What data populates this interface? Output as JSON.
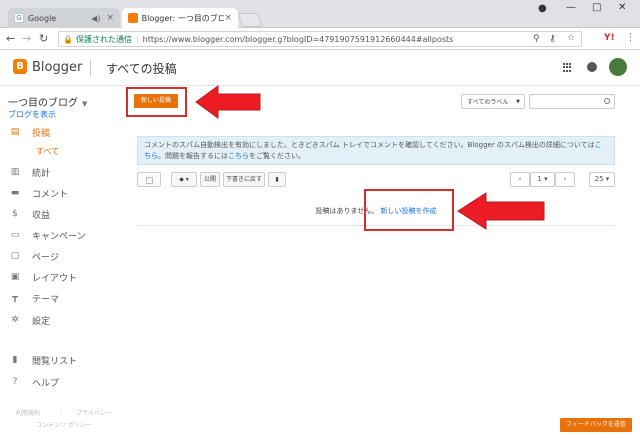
{
  "browser": {
    "tabs": [
      {
        "label": "Google"
      },
      {
        "label": "Blogger: 一つ目のブログ -"
      }
    ],
    "address": {
      "secure_label": "保護された通信",
      "url": "https://www.blogger.com/blogger.g?blogID=4791907591912660444#allposts"
    }
  },
  "header": {
    "app_name": "Blogger",
    "page_title": "すべての投稿",
    "logo_letter": "B"
  },
  "sidebar": {
    "blog_name": "一つ目のブログ",
    "view_blog": "ブログを表示",
    "items": [
      {
        "label": "投稿",
        "icon": "posts-icon"
      },
      {
        "label": "統計",
        "icon": "stats-icon"
      },
      {
        "label": "コメント",
        "icon": "comment-icon"
      },
      {
        "label": "収益",
        "icon": "dollar-icon"
      },
      {
        "label": "キャンペーン",
        "icon": "campaign-icon"
      },
      {
        "label": "ページ",
        "icon": "page-icon"
      },
      {
        "label": "レイアウト",
        "icon": "layout-icon"
      },
      {
        "label": "テーマ",
        "icon": "theme-icon"
      },
      {
        "label": "設定",
        "icon": "gear-icon"
      },
      {
        "label": "閲覧リスト",
        "icon": "bookmark-icon"
      },
      {
        "label": "ヘルプ",
        "icon": "help-icon"
      }
    ],
    "sub_item": "すべて",
    "footer": {
      "terms": "利用規約",
      "privacy": "プライバシー",
      "content_policy": "コンテンツ ポリシー"
    }
  },
  "main": {
    "new_post_button": "新しい投稿",
    "labels_dropdown": "すべてのラベル",
    "notice": {
      "text1": "コメントのスパム自動検出を有効にしました。ときどきスパム トレイでコメントを確認してください。Blogger のスパム検出の詳細については",
      "link1": "こちら",
      "text2": "。問題を報告するには",
      "link2": "こちら",
      "text3": "をご覧ください。"
    },
    "toolbar": {
      "publish": "公開",
      "revert": "下書きに戻す",
      "page_number": "1",
      "per_page": "25"
    },
    "empty": {
      "text": "投稿はありません。",
      "link": "新しい投稿を作成"
    }
  },
  "feedback_button": "フィードバックを送信",
  "colors": {
    "accent": "#e8710a",
    "annotation": "#d32f2f",
    "link": "#1a73e8"
  }
}
